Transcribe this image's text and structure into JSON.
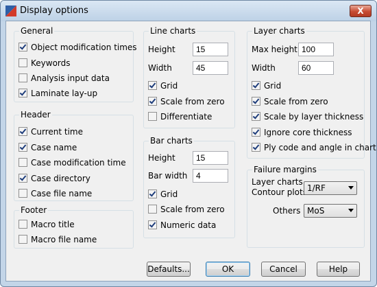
{
  "window": {
    "title": "Display options",
    "close_label": "X"
  },
  "general": {
    "title": "General",
    "items": [
      {
        "label": "Object modification times",
        "checked": true
      },
      {
        "label": "Keywords",
        "checked": false
      },
      {
        "label": "Analysis input data",
        "checked": false
      },
      {
        "label": "Laminate lay-up",
        "checked": true
      }
    ]
  },
  "header": {
    "title": "Header",
    "items": [
      {
        "label": "Current time",
        "checked": true
      },
      {
        "label": "Case name",
        "checked": true
      },
      {
        "label": "Case modification time",
        "checked": false
      },
      {
        "label": "Case directory",
        "checked": true
      },
      {
        "label": "Case file name",
        "checked": false
      }
    ]
  },
  "footer": {
    "title": "Footer",
    "items": [
      {
        "label": "Macro title",
        "checked": false
      },
      {
        "label": "Macro file name",
        "checked": false
      }
    ]
  },
  "line_charts": {
    "title": "Line charts",
    "height_label": "Height",
    "height_value": "15",
    "width_label": "Width",
    "width_value": "45",
    "items": [
      {
        "label": "Grid",
        "checked": true
      },
      {
        "label": "Scale from zero",
        "checked": true
      },
      {
        "label": "Differentiate",
        "checked": false
      }
    ]
  },
  "bar_charts": {
    "title": "Bar charts",
    "height_label": "Height",
    "height_value": "15",
    "bar_width_label": "Bar width",
    "bar_width_value": "4",
    "items": [
      {
        "label": "Grid",
        "checked": true
      },
      {
        "label": "Scale from zero",
        "checked": false
      },
      {
        "label": "Numeric data",
        "checked": true
      }
    ]
  },
  "layer_charts": {
    "title": "Layer charts",
    "max_height_label": "Max height",
    "max_height_value": "100",
    "width_label": "Width",
    "width_value": "60",
    "items": [
      {
        "label": "Grid",
        "checked": true
      },
      {
        "label": "Scale from zero",
        "checked": true
      },
      {
        "label": "Scale by layer thickness",
        "checked": true
      },
      {
        "label": "Ignore core thickness",
        "checked": true
      },
      {
        "label": "Ply code and angle in chart",
        "checked": true
      }
    ]
  },
  "failure_margins": {
    "title": "Failure margins",
    "layer_label_1": "Layer charts",
    "layer_label_2": "Contour plots",
    "layer_value": "1/RF",
    "others_label": "Others",
    "others_value": "MoS"
  },
  "buttons": {
    "defaults": "Defaults...",
    "ok": "OK",
    "cancel": "Cancel",
    "help": "Help"
  }
}
